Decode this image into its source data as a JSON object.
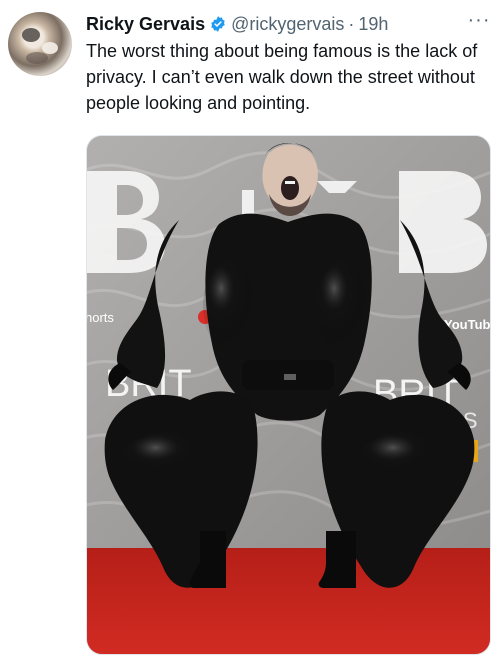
{
  "tweet": {
    "author_name": "Ricky Gervais",
    "handle": "@rickygervais",
    "separator": "·",
    "timestamp": "19h",
    "more_label": "···",
    "text": "The worst thing about being famous is the lack of privacy. I can’t even walk down the street without people looking and pointing."
  },
  "media": {
    "background_texts": [
      "BRIT",
      "horts",
      "YouTube",
      "BRIT",
      "BRIT",
      "DS"
    ]
  },
  "colors": {
    "verified": "#1d9bf0",
    "text_primary": "#0f1419",
    "text_secondary": "#536471",
    "carpet": "#c8231b",
    "suit": "#111111"
  },
  "icons": {
    "verified": "verified-badge-icon",
    "more": "more-options-icon"
  }
}
